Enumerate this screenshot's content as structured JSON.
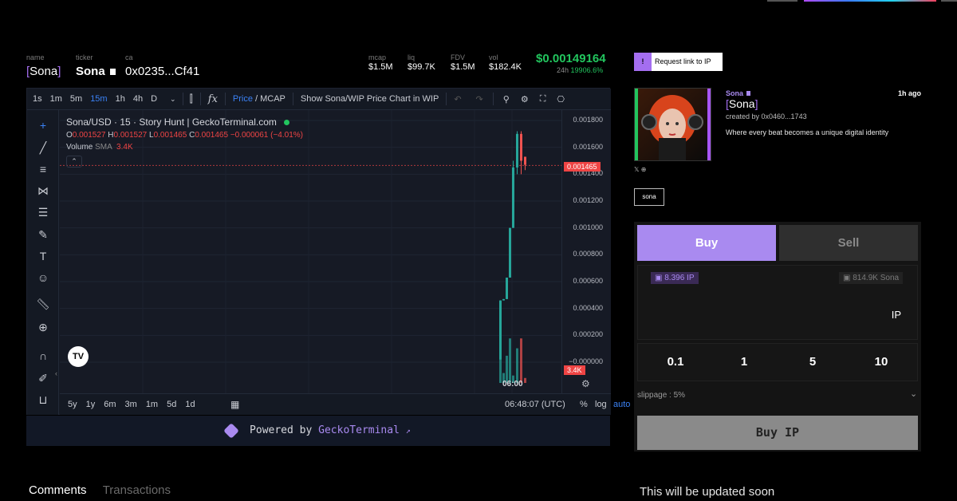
{
  "token": {
    "labels": {
      "name": "name",
      "ticker": "ticker",
      "ca": "ca"
    },
    "name": "[Sona]",
    "ticker": "Sona",
    "ca": "0x0235...Cf41"
  },
  "stats": [
    {
      "label": "mcap",
      "value": "$1.5M"
    },
    {
      "label": "liq",
      "value": "$99.7K"
    },
    {
      "label": "FDV",
      "value": "$1.5M"
    },
    {
      "label": "vol",
      "value": "$182.4K"
    }
  ],
  "price": {
    "value": "$0.00149164",
    "period": "24h",
    "change": "19906.6%"
  },
  "toolbar": {
    "intervals": [
      "1s",
      "1m",
      "5m",
      "15m",
      "1h",
      "4h",
      "D"
    ],
    "active_interval": "15m",
    "price_label": "Price",
    "mcap_label": "/ MCAP",
    "show_label": "Show Sona/WIP Price Chart in WIP"
  },
  "chart": {
    "title": "Sona/USD · 15 · Story Hunt | GeckoTerminal.com",
    "ohlc_o": "0.001527",
    "ohlc_h": "0.001527",
    "ohlc_l": "0.001465",
    "ohlc_c": "0.001465",
    "ohlc_change": "−0.000061 (−4.01%)",
    "volume_label": "Volume",
    "sma_label": "SMA",
    "volume_value": "3.4K",
    "y_ticks": [
      "0.001800",
      "0.001600",
      "0.001400",
      "0.001200",
      "0.001000",
      "0.000800",
      "0.000600",
      "0.000400",
      "0.000200",
      "−0.000000"
    ],
    "last_price_tag": "0.001465",
    "volume_tag": "3.4K",
    "x_label": "06:00",
    "ranges": [
      "5y",
      "1y",
      "6m",
      "3m",
      "1m",
      "5d",
      "1d"
    ],
    "clock": "06:48:07 (UTC)",
    "scale_opts": [
      "%",
      "log",
      "auto"
    ]
  },
  "chart_data": {
    "type": "candlestick",
    "ylim": [
      0,
      0.0019
    ],
    "candles": [
      {
        "o": 2e-05,
        "c": 0.00046,
        "h": 0.00046,
        "l": 2e-05,
        "dir": "up"
      },
      {
        "o": 0.00046,
        "c": 0.00047,
        "h": 0.00047,
        "l": 0.00046,
        "dir": "up"
      },
      {
        "o": 0.00047,
        "c": 0.00063,
        "h": 0.00063,
        "l": 0.00047,
        "dir": "up"
      },
      {
        "o": 0.00063,
        "c": 0.001,
        "h": 0.001,
        "l": 0.00063,
        "dir": "up"
      },
      {
        "o": 0.001,
        "c": 0.00145,
        "h": 0.0015,
        "l": 0.001,
        "dir": "up"
      },
      {
        "o": 0.00145,
        "c": 0.0017,
        "h": 0.00172,
        "l": 0.0014,
        "dir": "up"
      },
      {
        "o": 0.0017,
        "c": 0.0015,
        "h": 0.00172,
        "l": 0.0014,
        "dir": "down"
      },
      {
        "o": 0.00153,
        "c": 0.00147,
        "h": 0.00153,
        "l": 0.00143,
        "dir": "down"
      }
    ],
    "volume_frac": [
      0.55,
      0.2,
      0.55,
      0.9,
      0.15,
      0.7,
      0.9,
      0.1
    ]
  },
  "powered": {
    "text": "Powered by",
    "brand": "GeckoTerminal",
    "arrow": "↗"
  },
  "bottom_tabs": {
    "comments": "Comments",
    "transactions": "Transactions"
  },
  "right": {
    "request_link": "Request link to IP",
    "bang": "!",
    "profile": {
      "ticker": "Sona",
      "time": "1h ago",
      "name": "[Sona]",
      "created_by": "created by 0x0460...1743",
      "description": "Where every beat becomes a unique digital identity",
      "tag": "sona"
    },
    "trade": {
      "buy_label": "Buy",
      "sell_label": "Sell",
      "ip_balance": "8.396 IP",
      "token_balance": "814.9K Sona",
      "unit": "IP",
      "quick_amounts": [
        "0.1",
        "1",
        "5",
        "10"
      ],
      "slippage": "slippage : 5%",
      "buy_button": "Buy IP"
    },
    "updated_soon": "This will be updated soon"
  }
}
